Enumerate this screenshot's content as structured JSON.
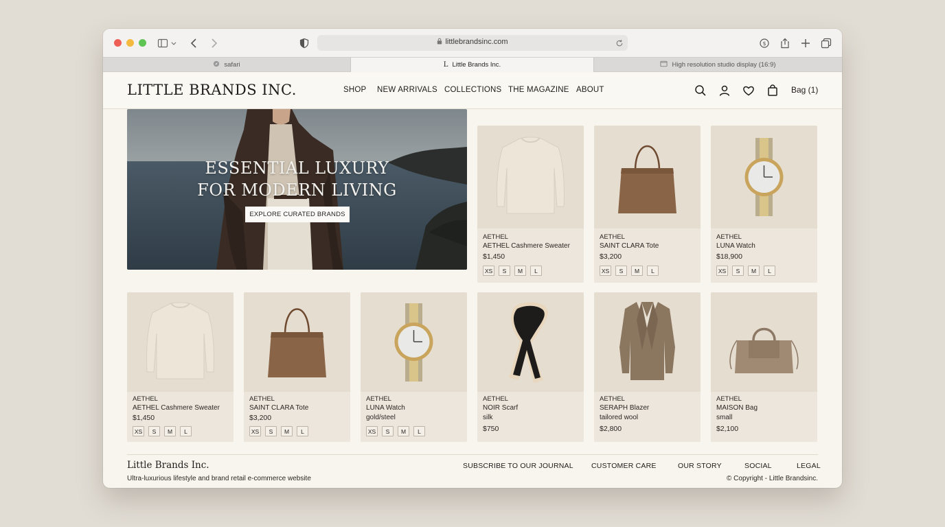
{
  "browser": {
    "url": "littlebrandsinc.com",
    "tabs": [
      {
        "label": "safari",
        "icon": "compass-icon"
      },
      {
        "label": "Little Brands Inc.",
        "icon": "site-favicon"
      },
      {
        "label": "High resolution studio display (16:9)",
        "icon": "window-icon"
      }
    ]
  },
  "header": {
    "logo": "LITTLE BRANDS INC.",
    "nav": [
      "SHOP",
      "NEW ARRIVALS",
      "COLLECTIONS",
      "THE MAGAZINE",
      "ABOUT"
    ],
    "bag": "Bag (1)"
  },
  "hero": {
    "title_line1": "ESSENTIAL LUXURY",
    "title_line2": "FOR MODERN LIVING",
    "cta": "EXPLORE CURATED BRANDS"
  },
  "featured": [
    {
      "brand": "AETHEL",
      "name": "AETHEL Cashmere Sweater",
      "price": "$1,450",
      "sizes": [
        "XS",
        "S",
        "M",
        "L"
      ],
      "image": "sweater"
    },
    {
      "brand": "AETHEL",
      "name": "SAINT CLARA Tote",
      "price": "$3,200",
      "sizes": [
        "XS",
        "S",
        "M",
        "L"
      ],
      "image": "tote"
    },
    {
      "brand": "AETHEL",
      "name": "LUNA Watch",
      "price": "$18,900",
      "sizes": [
        "XS",
        "S",
        "M",
        "L"
      ],
      "image": "watch"
    }
  ],
  "products": [
    {
      "brand": "AETHEL",
      "name": "AETHEL Cashmere Sweater",
      "detail": "",
      "price": "$1,450",
      "sizes": [
        "XS",
        "S",
        "M",
        "L"
      ],
      "image": "sweater"
    },
    {
      "brand": "AETHEL",
      "name": "SAINT CLARA Tote",
      "detail": "",
      "price": "$3,200",
      "sizes": [
        "XS",
        "S",
        "M",
        "L"
      ],
      "image": "tote"
    },
    {
      "brand": "AETHEL",
      "name": "LUNA Watch",
      "detail": "gold/steel",
      "price": "",
      "sizes": [
        "XS",
        "S",
        "M",
        "L"
      ],
      "image": "watch"
    },
    {
      "brand": "AETHEL",
      "name": "NOIR Scarf",
      "detail": "silk",
      "price": "$750",
      "sizes": [],
      "image": "scarf"
    },
    {
      "brand": "AETHEL",
      "name": "SERAPH Blazer",
      "detail": "tailored wool",
      "price": "$2,800",
      "sizes": [],
      "image": "blazer"
    },
    {
      "brand": "AETHEL",
      "name": "MAISON Bag",
      "detail": "small",
      "price": "$2,100",
      "sizes": [],
      "image": "handbag"
    }
  ],
  "footer": {
    "logo": "Little Brands Inc.",
    "tagline": "Ultra-luxurious lifestyle and brand retail e-commerce website",
    "links": [
      "SUBSCRIBE TO OUR JOURNAL",
      "CUSTOMER CARE",
      "OUR STORY",
      "SOCIAL",
      "LEGAL"
    ],
    "copyright": "© Copyright - Little Brandsinc."
  },
  "colors": {
    "page_bg": "#f8f5ee",
    "card_bg": "#ece6dc",
    "image_bg": "#e6ddd1",
    "text": "#1e1c1a"
  }
}
